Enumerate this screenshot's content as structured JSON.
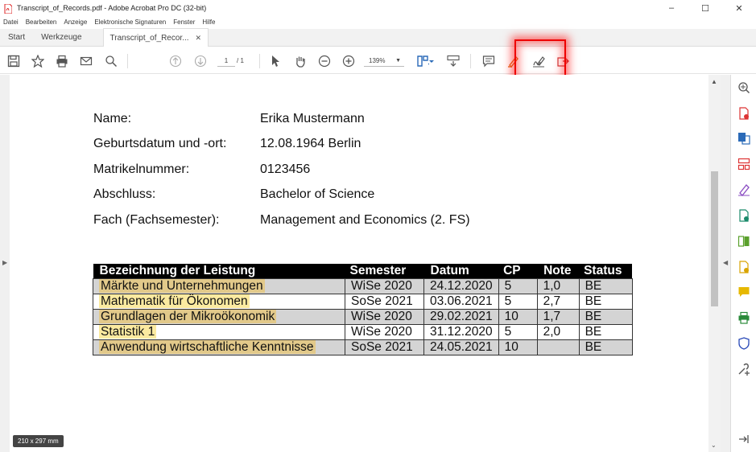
{
  "window": {
    "title": "Transcript_of_Records.pdf - Adobe Acrobat Pro DC (32-bit)",
    "controls": [
      "–",
      "☐",
      "✕"
    ]
  },
  "menu": [
    "Datei",
    "Bearbeiten",
    "Anzeige",
    "Elektronische Signaturen",
    "Fenster",
    "Hilfe"
  ],
  "tabs": {
    "start": "Start",
    "tools": "Werkzeuge",
    "document": "Transcript_of_Recor...",
    "close": "✕"
  },
  "toolbar": {
    "page_current": "1",
    "page_total": "/ 1",
    "zoom": "139%",
    "highlighted_tool": "sign-tool",
    "highlight_color": "#ff0000"
  },
  "document": {
    "fields": [
      {
        "label": "Name:",
        "value": "Erika Mustermann"
      },
      {
        "label": "Geburtsdatum und -ort:",
        "value": "12.08.1964 Berlin"
      },
      {
        "label": "Matrikelnummer:",
        "value": "0123456"
      },
      {
        "label": "Abschluss:",
        "value": "Bachelor of Science"
      },
      {
        "label": "Fach (Fachsemester):",
        "value": "Management and Economics (2. FS)"
      }
    ],
    "table": {
      "headers": [
        "Bezeichnung der Leistung",
        "Semester",
        "Datum",
        "CP",
        "Note",
        "Status"
      ],
      "rows": [
        [
          "Märkte und Unternehmungen",
          "WiSe 2020",
          "24.12.2020",
          "5",
          "1,0",
          "BE"
        ],
        [
          "Mathematik für Ökonomen",
          "SoSe 2021",
          "03.06.2021",
          "5",
          "2,7",
          "BE"
        ],
        [
          "Grundlagen der Mikroökonomik",
          "WiSe 2020",
          "29.02.2021",
          "10",
          "1,7",
          "BE"
        ],
        [
          "Statistik 1",
          "WiSe 2020",
          "31.12.2020",
          "5",
          "2,0",
          "BE"
        ],
        [
          "Anwendung wirtschaftliche Kenntnisse",
          "SoSe 2021",
          "24.05.2021",
          "10",
          "",
          "BE"
        ]
      ]
    }
  },
  "page_size_badge": "210 x 297 mm"
}
